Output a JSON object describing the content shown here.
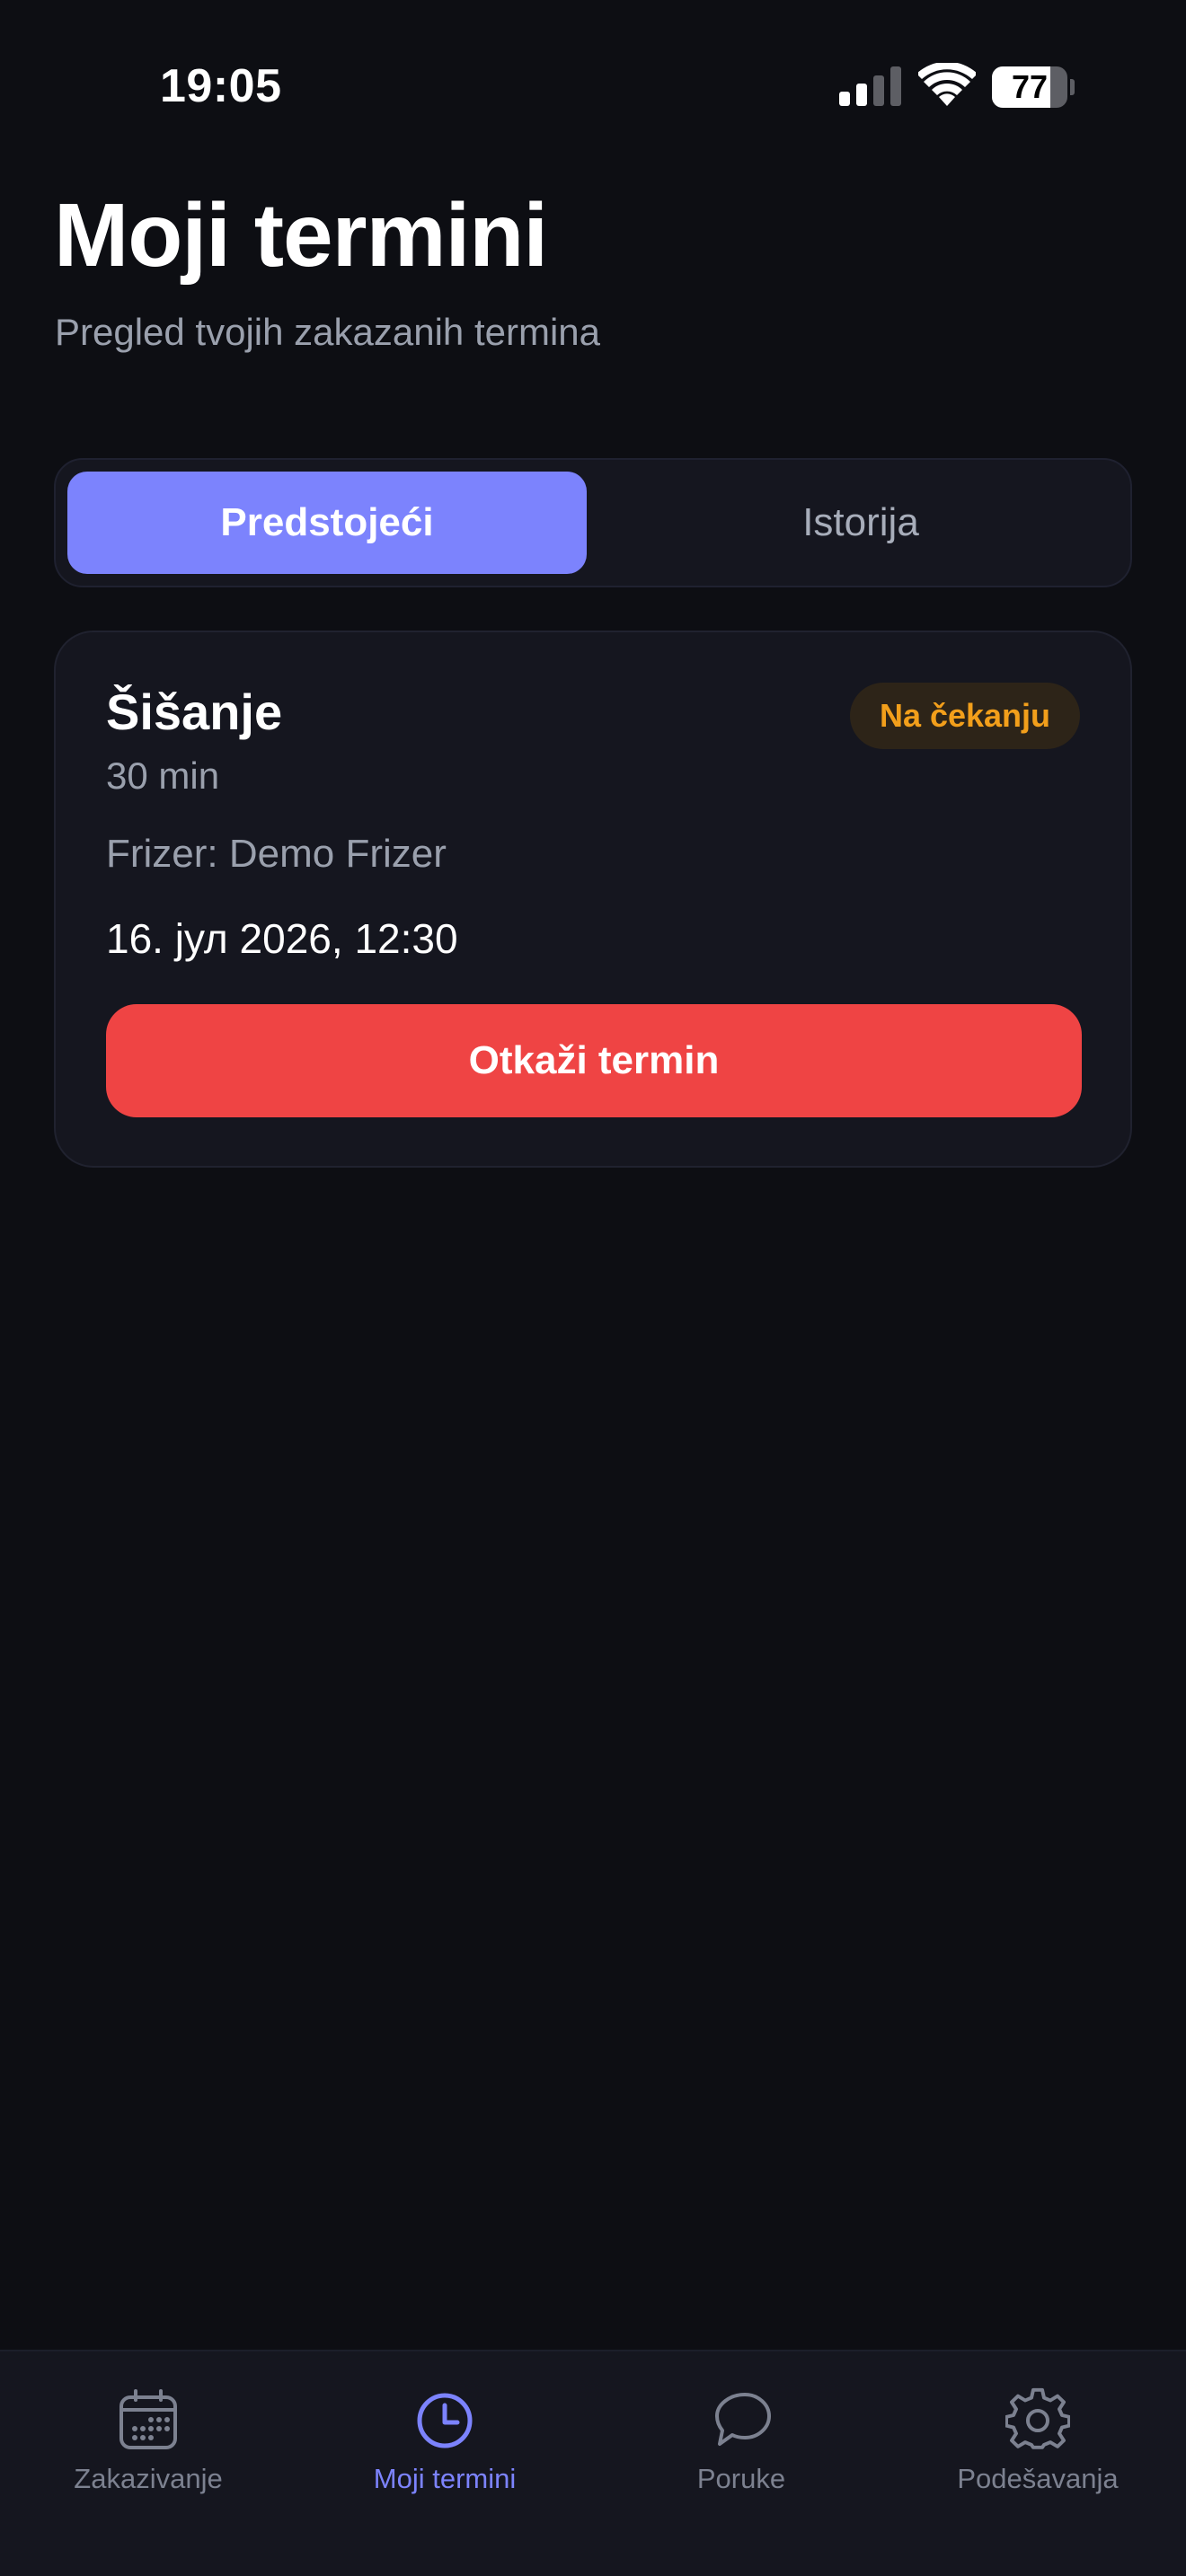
{
  "status_bar": {
    "time": "19:05",
    "battery_level": "77",
    "battery_fraction": 0.77
  },
  "header": {
    "title": "Moji termini",
    "subtitle": "Pregled tvojih zakazanih termina"
  },
  "tabs": [
    {
      "label": "Predstojeći",
      "active": true
    },
    {
      "label": "Istorija",
      "active": false
    }
  ],
  "appointments": [
    {
      "service": "Šišanje",
      "status": "Na čekanju",
      "duration": "30 min",
      "barber": "Frizer: Demo Frizer",
      "datetime": "16. јул 2026, 12:30",
      "cancel_label": "Otkaži termin"
    }
  ],
  "bottom_nav": [
    {
      "label": "Zakazivanje",
      "icon": "calendar-icon",
      "active": false
    },
    {
      "label": "Moji termini",
      "icon": "clock-icon",
      "active": true
    },
    {
      "label": "Poruke",
      "icon": "chat-bubble-icon",
      "active": false
    },
    {
      "label": "Podešavanja",
      "icon": "gear-icon",
      "active": false
    }
  ],
  "colors": {
    "background": "#0d0e13",
    "surface": "#15161f",
    "accent": "#7c83fd",
    "danger": "#ef4444",
    "pending": "#f29f1b",
    "muted_text": "#9aa0ad"
  }
}
